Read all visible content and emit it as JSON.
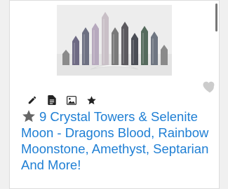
{
  "listing": {
    "title": "9 Crystal Towers & Selenite Moon - Dragons Blood, Rainbow Moonstone, Amethyst, Septarian And More!",
    "image_icon": "photo",
    "favorite_icon": "heart-icon",
    "title_badge_icon": "star-icon",
    "toolbar": [
      {
        "icon": "pencil-icon"
      },
      {
        "icon": "document-icon"
      },
      {
        "icon": "image-icon"
      },
      {
        "icon": "star-icon"
      }
    ]
  },
  "colors": {
    "title": "#1f7fd4",
    "icon": "#222222",
    "heart": "#cccccc",
    "star": "#666666"
  }
}
